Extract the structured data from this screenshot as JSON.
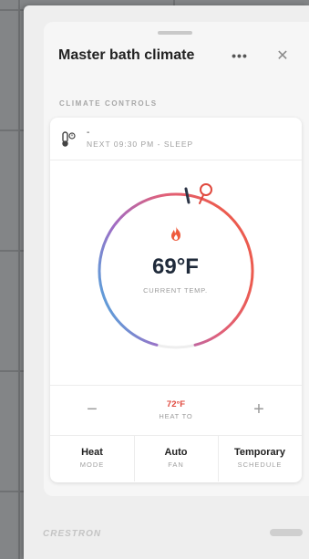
{
  "panel": {
    "title": "Master bath climate",
    "more_label": "•••",
    "close_label": "✕",
    "section_label": "CLIMATE CONTROLS"
  },
  "schedule": {
    "current": "-",
    "next": "NEXT 09:30 PM - SLEEP"
  },
  "thermostat": {
    "current_temp": "69°F",
    "current_label": "CURRENT TEMP.",
    "setpoint": "72°F",
    "setpoint_label": "HEAT TO",
    "minus_label": "−",
    "plus_label": "+"
  },
  "modes": [
    {
      "value": "Heat",
      "label": "MODE"
    },
    {
      "value": "Auto",
      "label": "FAN"
    },
    {
      "value": "Temporary",
      "label": "SCHEDULE"
    }
  ],
  "brand": "CRESTRON",
  "colors": {
    "accent_heat": "#e0493e",
    "ring_cool": "#3bb7e3",
    "ring_mid": "#b46db8"
  }
}
